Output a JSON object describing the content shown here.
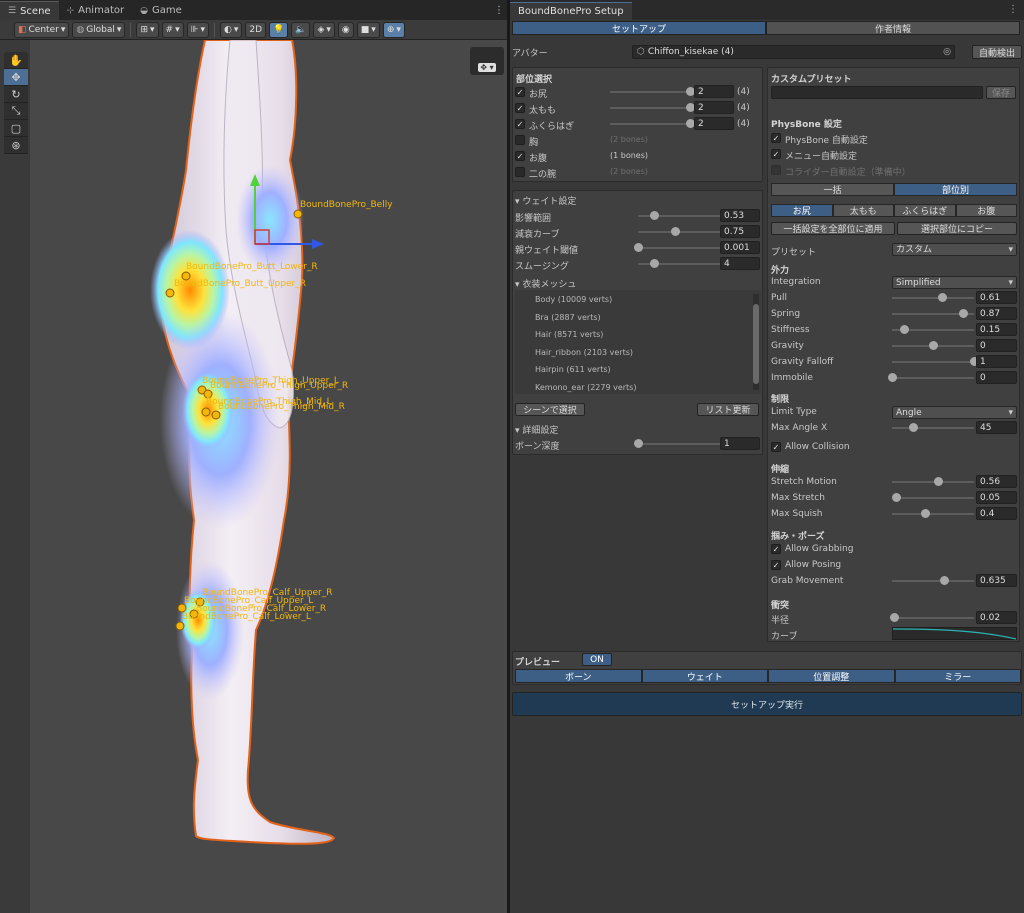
{
  "scene_tabs": [
    {
      "label": "Scene"
    },
    {
      "label": "Animator"
    },
    {
      "label": "Game"
    }
  ],
  "scene_toolbar": {
    "pivot": "Center",
    "space": "Global",
    "twod": "2D"
  },
  "bones": [
    "BoundBonePro_Belly",
    "BoundBonePro_Butt_Lower_R",
    "BoundBonePro_Butt_Upper_R",
    "BoundBonePro_Thigh_Upper_L",
    "BoundBonePro_Thigh_Upper_R",
    "BoundBonePro_Thigh_Mid_L",
    "BoundBonePro_Thigh_Mid_R",
    "BoundBonePro_Calf_Upper_R",
    "BoundBonePro_Calf_Upper_L",
    "BoundBonePro_Calf_Lower_R",
    "BoundBonePro_Calf_Lower_L"
  ],
  "window": {
    "title": "BoundBonePro Setup",
    "tabs": [
      "セットアップ",
      "作者情報"
    ]
  },
  "avatar": {
    "label": "アバター",
    "value": "Chiffon_kisekae (4)",
    "auto_button": "自動検出"
  },
  "parts": {
    "header": "部位選択",
    "items": [
      {
        "label": "お尻",
        "checked": true,
        "value": "2",
        "count": "(4)"
      },
      {
        "label": "太もも",
        "checked": true,
        "value": "2",
        "count": "(4)"
      },
      {
        "label": "ふくらはぎ",
        "checked": true,
        "value": "2",
        "count": "(4)"
      },
      {
        "label": "胸",
        "checked": false,
        "note": "(2 bones)"
      },
      {
        "label": "お腹",
        "checked": true,
        "note": "(1 bones)"
      },
      {
        "label": "二の腕",
        "checked": false,
        "note": "(2 bones)"
      }
    ]
  },
  "weight": {
    "header": "ウェイト設定",
    "rows": [
      {
        "label": "影響範囲",
        "value": "0.53",
        "pos": 0.2
      },
      {
        "label": "減衰カーブ",
        "value": "0.75",
        "pos": 0.45
      },
      {
        "label": "親ウェイト閾値",
        "value": "0.001",
        "pos": 0.0
      },
      {
        "label": "スムージング",
        "value": "4",
        "pos": 0.2
      }
    ]
  },
  "costume": {
    "header": "衣装メッシュ",
    "items": [
      "Body (10009 verts)",
      "Bra (2887 verts)",
      "Hair (8571 verts)",
      "Hair_ribbon (2103 verts)",
      "Hairpin (611 verts)",
      "Kemono_ear (2279 verts)"
    ],
    "select_button": "シーンで選択",
    "refresh_button": "リスト更新"
  },
  "detail": {
    "header": "詳細設定",
    "label": "ボーン深度",
    "value": "1"
  },
  "custom_preset": {
    "header": "カスタムプリセット",
    "save": "保存"
  },
  "physbone": {
    "header": "PhysBone 設定",
    "options": [
      {
        "label": "PhysBone 自動設定",
        "checked": true,
        "disabled": false
      },
      {
        "label": "メニュー自動設定",
        "checked": true,
        "disabled": false
      },
      {
        "label": "コライダー自動設定（準備中）",
        "checked": false,
        "disabled": true
      }
    ],
    "mode_tabs": [
      "一括",
      "部位別"
    ],
    "part_tabs": [
      "お尻",
      "太もも",
      "ふくらはぎ",
      "お腹"
    ],
    "apply_all": "一括設定を全部位に適用",
    "copy_to": "選択部位にコピー",
    "preset_label": "プリセット",
    "preset_value": "カスタム",
    "force_header": "外力",
    "integration_label": "Integration",
    "integration_value": "Simplified",
    "force_rows": [
      {
        "label": "Pull",
        "value": "0.61",
        "pos": 0.61
      },
      {
        "label": "Spring",
        "value": "0.87",
        "pos": 0.87
      },
      {
        "label": "Stiffness",
        "value": "0.15",
        "pos": 0.15
      },
      {
        "label": "Gravity",
        "value": "0",
        "pos": 0.5
      },
      {
        "label": "Gravity Falloff",
        "value": "1",
        "pos": 1.0
      },
      {
        "label": "Immobile",
        "value": "0",
        "pos": 0.0
      }
    ],
    "limit_header": "制限",
    "limit_type_label": "Limit Type",
    "limit_type_value": "Angle",
    "max_angle_label": "Max Angle X",
    "max_angle_value": "45",
    "max_angle_pos": 0.25,
    "allow_collision": "Allow Collision",
    "stretch_header": "伸縮",
    "stretch_rows": [
      {
        "label": "Stretch Motion",
        "value": "0.56",
        "pos": 0.56
      },
      {
        "label": "Max Stretch",
        "value": "0.05",
        "pos": 0.05
      },
      {
        "label": "Max Squish",
        "value": "0.4",
        "pos": 0.4
      }
    ],
    "grab_header": "掴み・ポーズ",
    "allow_grabbing": "Allow Grabbing",
    "allow_posing": "Allow Posing",
    "grab_movement_label": "Grab Movement",
    "grab_movement_value": "0.635",
    "grab_movement_pos": 0.635,
    "collision_header": "衝突",
    "radius_label": "半径",
    "radius_value": "0.02",
    "radius_pos": 0.02,
    "curve_label": "カーブ"
  },
  "preview": {
    "label": "プレビュー",
    "state": "ON",
    "tabs": [
      "ボーン",
      "ウェイト",
      "位置調整",
      "ミラー"
    ]
  },
  "run_button": "セットアップ実行",
  "colors": {
    "accent": "#3e5f85",
    "bone": "#f2b70a",
    "run": "#1f3a52"
  }
}
